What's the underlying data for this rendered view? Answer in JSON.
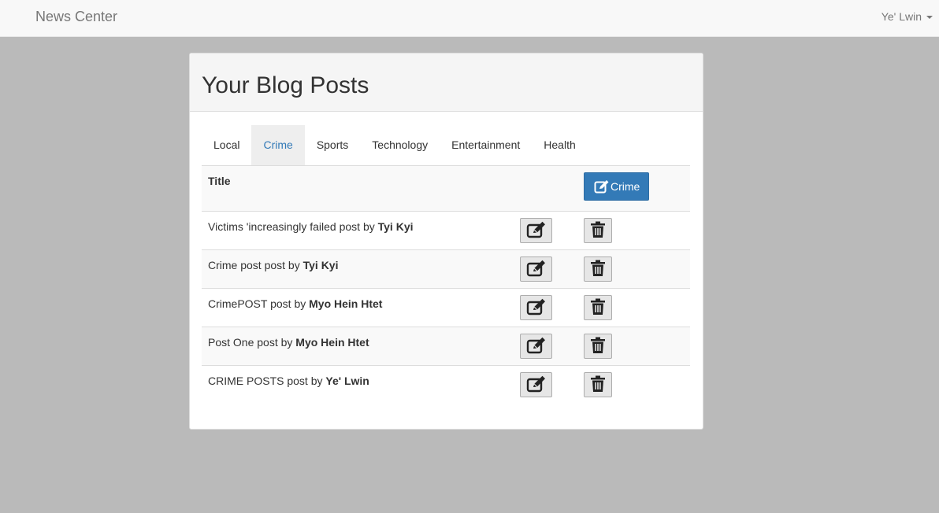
{
  "navbar": {
    "brand": "News Center",
    "user": "Ye' Lwin"
  },
  "panel": {
    "title": "Your Blog Posts"
  },
  "tabs": [
    {
      "label": "Local"
    },
    {
      "label": "Crime"
    },
    {
      "label": "Sports"
    },
    {
      "label": "Technology"
    },
    {
      "label": "Entertainment"
    },
    {
      "label": "Health"
    }
  ],
  "active_tab": "Crime",
  "table": {
    "header_title": "Title",
    "add_button_label": "Crime",
    "post_by": "post by",
    "rows": [
      {
        "title": "Victims 'increasingly failed",
        "author": "Tyi Kyi"
      },
      {
        "title": "Crime post",
        "author": "Tyi Kyi"
      },
      {
        "title": "CrimePOST",
        "author": "Myo Hein Htet"
      },
      {
        "title": "Post One",
        "author": "Myo Hein Htet"
      },
      {
        "title": "CRIME POSTS",
        "author": "Ye' Lwin"
      }
    ]
  },
  "icons": {
    "add": "edit-icon",
    "edit": "edit-icon",
    "delete": "trash-icon",
    "user_menu": "chevron-down-icon"
  },
  "colors": {
    "primary": "#337ab7",
    "active_tab_bg": "#eeeeee",
    "page_bg": "#bababa"
  }
}
